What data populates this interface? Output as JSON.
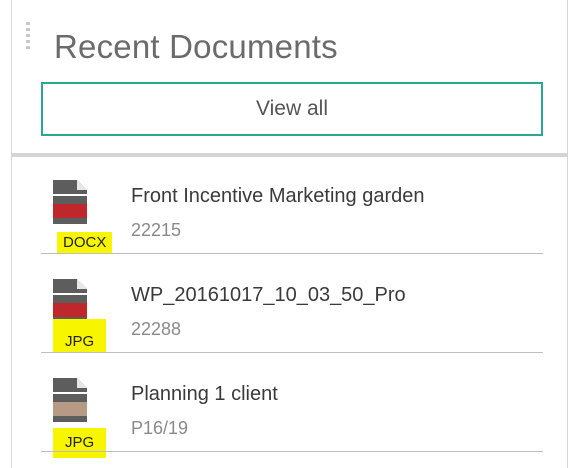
{
  "panel": {
    "title": "Recent Documents",
    "view_all_label": "View all"
  },
  "documents": [
    {
      "name": "Front Incentive Marketing garden",
      "meta": "22215",
      "file_type": "DOCX",
      "icon_band_color": "#c0272d",
      "highlight_color": "#f8f500"
    },
    {
      "name": "WP_20161017_10_03_50_Pro",
      "meta": "22288",
      "file_type": "JPG",
      "icon_band_color": "#c0272d",
      "highlight_color": "#f8f500"
    },
    {
      "name": "Planning 1 client",
      "meta": "P16/19",
      "file_type": "JPG",
      "icon_band_color": "#b79a86",
      "highlight_color": "#f8f500"
    }
  ],
  "colors": {
    "accent": "#2aa88f",
    "icon_gray": "#5d5d5d"
  }
}
